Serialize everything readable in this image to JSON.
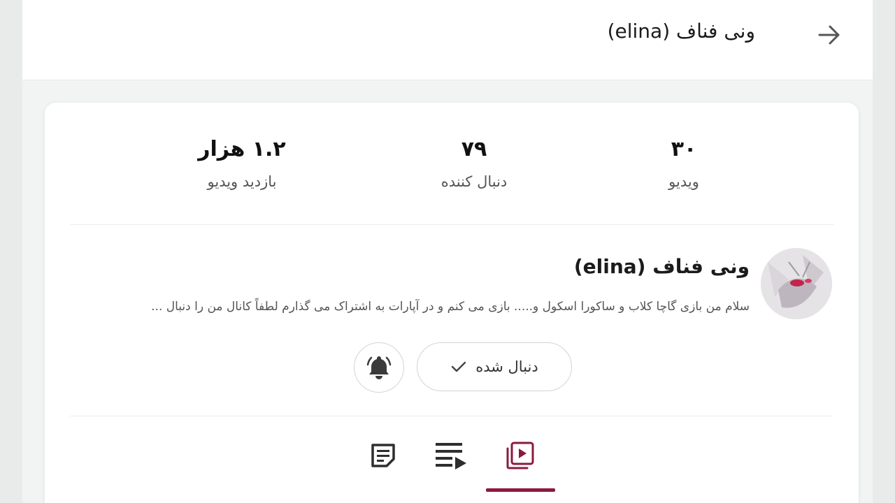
{
  "header": {
    "title": "ونی فناف (elina)",
    "back_icon": "arrow-right-icon"
  },
  "stats": [
    {
      "value": "۳۰",
      "label": "ویدیو"
    },
    {
      "value": "۷۹",
      "label": "دنبال کننده"
    },
    {
      "value": "۱.۲ هزار",
      "label": "بازدید ویدیو"
    }
  ],
  "channel": {
    "name": "ونی فناف (elina)",
    "description": "سلام من بازی گاچا کلاب و ساکورا اسکول و..... بازی می کنم و در آپارات به اشتراک می گذارم لطفاً کانال من را دنبال ..."
  },
  "actions": {
    "follow_label": "دنبال شده",
    "follow_icon": "check-icon",
    "bell_icon": "bell-icon"
  },
  "tabs": [
    {
      "icon": "videos-icon",
      "active": true
    },
    {
      "icon": "playlist-icon",
      "active": false
    },
    {
      "icon": "about-icon",
      "active": false
    }
  ],
  "colors": {
    "accent": "#8b1a3f",
    "background": "#f2f3f3",
    "card": "#ffffff"
  }
}
